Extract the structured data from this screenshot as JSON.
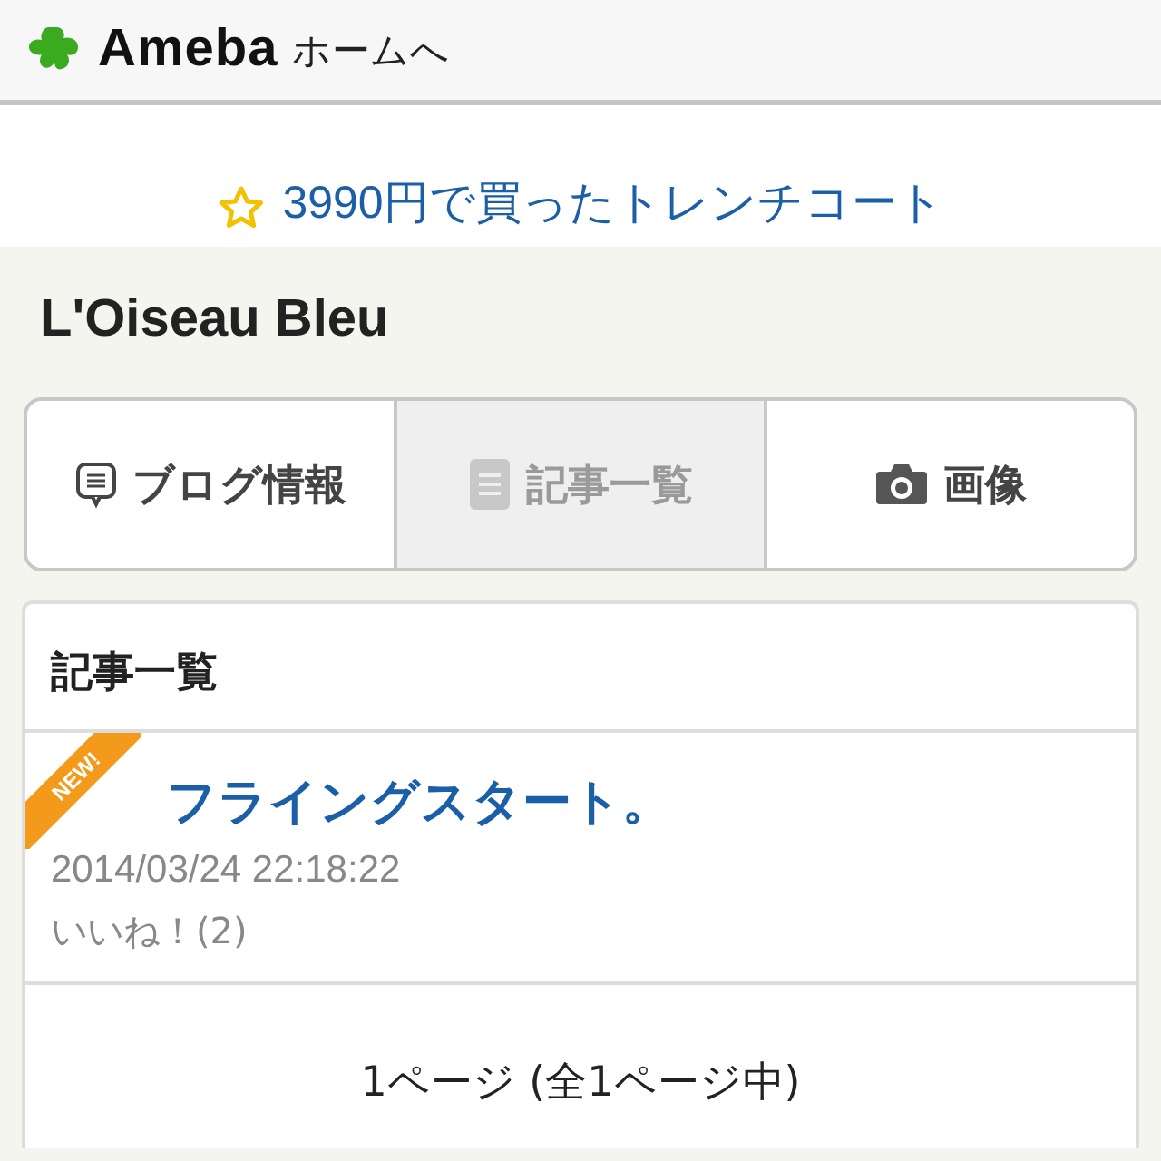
{
  "header": {
    "logo": "Ameba",
    "home_link": "ホームへ"
  },
  "banner": {
    "text": "3990円で買ったトレンチコート"
  },
  "blog_title": "L'Oiseau Bleu",
  "tabs": [
    {
      "kind": "info",
      "label": "ブログ情報",
      "selected": false
    },
    {
      "kind": "list",
      "label": "記事一覧",
      "selected": true
    },
    {
      "kind": "images",
      "label": "画像",
      "selected": false
    }
  ],
  "section_title": "記事一覧",
  "entries": [
    {
      "is_new": true,
      "badge": "NEW!",
      "title": "フライングスタート。",
      "date": "2014/03/24 22:18:22",
      "likes": "いいね！(2)"
    }
  ],
  "pagination": "1ページ (全1ページ中)"
}
